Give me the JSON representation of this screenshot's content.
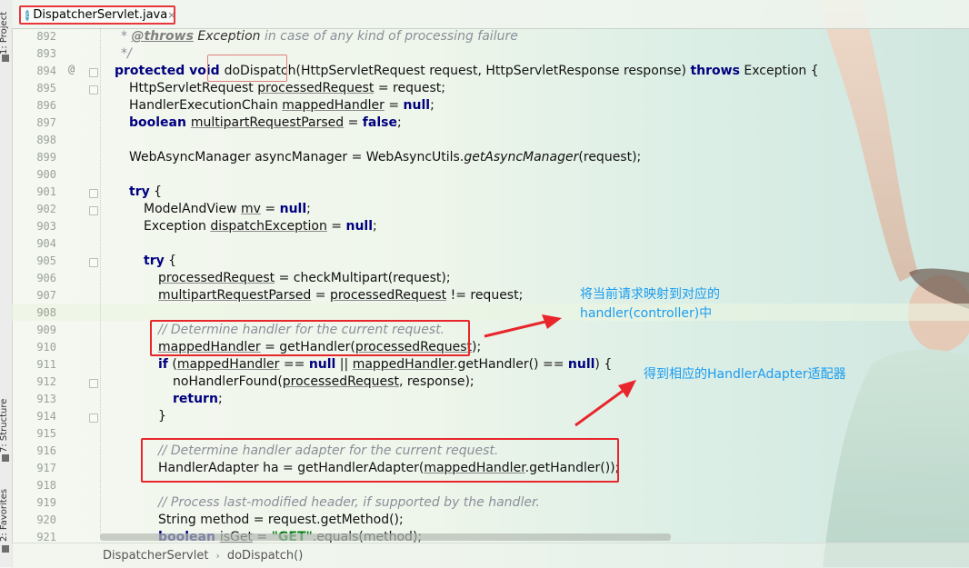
{
  "tool_window": {
    "project_label": "1: Project",
    "structure_label": "7: Structure",
    "favorites_label": "2: Favorites"
  },
  "tab": {
    "title": "DispatcherServlet.java",
    "icon": "class-icon",
    "close": "×"
  },
  "gutter": {
    "override_mark": "@",
    "line_numbers": [
      "892",
      "893",
      "894",
      "895",
      "896",
      "897",
      "898",
      "899",
      "900",
      "901",
      "902",
      "903",
      "904",
      "905",
      "906",
      "907",
      "908",
      "909",
      "910",
      "911",
      "912",
      "913",
      "914",
      "915",
      "916",
      "917",
      "918",
      "919",
      "920",
      "921"
    ]
  },
  "code": {
    "l892_star": "* ",
    "l892_tag": "@throws",
    "l892_type": " Exception",
    "l892_rest": " in case of any kind of processing failure",
    "l893": "*/",
    "l894_kw": "protected void ",
    "l894_name": "doDispatch",
    "l894_params": "(HttpServletRequest request, HttpServletResponse response) ",
    "l894_throws": "throws",
    "l894_end": " Exception {",
    "l895_a": "HttpServletRequest ",
    "l895_var": "processedRequest",
    "l895_b": " = request;",
    "l896_a": "HandlerExecutionChain ",
    "l896_var": "mappedHandler",
    "l896_b": " = ",
    "l896_null": "null",
    "l896_c": ";",
    "l897_kw": "boolean ",
    "l897_var": "multipartRequestParsed",
    "l897_b": " = ",
    "l897_false": "false",
    "l897_c": ";",
    "l899_a": "WebAsyncManager asyncManager = WebAsyncUtils.",
    "l899_method": "getAsyncManager",
    "l899_b": "(request);",
    "l901_kw": "try",
    "l901_b": " {",
    "l902_a": "ModelAndView ",
    "l902_var": "mv",
    "l902_b": " = ",
    "l902_null": "null",
    "l902_c": ";",
    "l903_a": "Exception ",
    "l903_var": "dispatchException",
    "l903_b": " = ",
    "l903_null": "null",
    "l903_c": ";",
    "l905_kw": "try",
    "l905_b": " {",
    "l906_var": "processedRequest",
    "l906_b": " = checkMultipart(request);",
    "l907_var": "multipartRequestParsed",
    "l907_b": " = ",
    "l907_var2": "processedRequest",
    "l907_c": " != request;",
    "l909": "// Determine handler for the current request.",
    "l910_var": "mappedHandler",
    "l910_b": " = getHandler(",
    "l910_var2": "processedRequest",
    "l910_c": ");",
    "l911_kw": "if",
    "l911_b": " (",
    "l911_var": "mappedHandler",
    "l911_c": " == ",
    "l911_null": "null",
    "l911_d": " || ",
    "l911_var2": "mappedHandler",
    "l911_e": ".getHandler() == ",
    "l911_null2": "null",
    "l911_f": ") {",
    "l912_a": "noHandlerFound(",
    "l912_var": "processedRequest",
    "l912_b": ", response);",
    "l913_kw": "return",
    "l913_b": ";",
    "l914": "}",
    "l916": "// Determine handler adapter for the current request.",
    "l917_a": "HandlerAdapter ha = getHandlerAdapter(",
    "l917_var": "mappedHandler",
    "l917_b": ".getHandler());",
    "l919": "// Process last-modified header, if supported by the handler.",
    "l920": "String method = request.getMethod();",
    "l921_kw": "boolean ",
    "l921_var": "isGet",
    "l921_b": " = ",
    "l921_str": "\"GET\"",
    "l921_c": ".equals(method);"
  },
  "annotations": {
    "note1_line1": "将当前请求映射到对应的",
    "note1_line2": "handler(controller)中",
    "note2": "得到相应的HandlerAdapter适配器",
    "color": "#1a9cf0",
    "box_color": "#e8262b"
  },
  "breadcrumb": {
    "class_name": "DispatcherServlet",
    "separator": "›",
    "method_name": "doDispatch()"
  }
}
